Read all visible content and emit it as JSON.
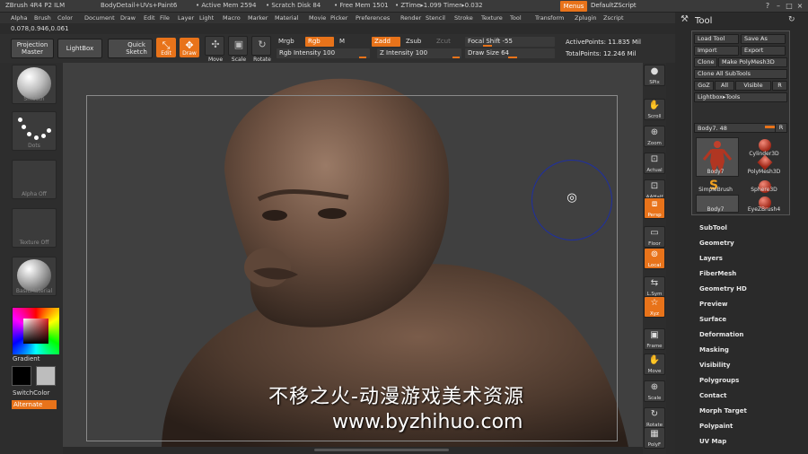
{
  "titlebar": {
    "app": "ZBrush 4R4 P2 ILM",
    "doc": "BodyDetail+UVs+Paint6",
    "active_mem": "• Active Mem 2594",
    "scratch": "• Scratch Disk 84",
    "free_mem": "• Free Mem 1501",
    "ztime": "• ZTime▸1.099  Timer▸0.032",
    "menus": "Menus",
    "script": "DefaultZScript"
  },
  "menubar": [
    "Alpha",
    "Brush",
    "Color",
    "Document",
    "Draw",
    "Edit",
    "File",
    "Layer",
    "Light",
    "Macro",
    "Marker",
    "Material",
    "Movie",
    "Picker",
    "Preferences",
    "Render",
    "Stencil",
    "Stroke",
    "Texture",
    "Tool",
    "Transform",
    "Zplugin",
    "Zscript"
  ],
  "shelf": {
    "coords": "0.078,0.946,0.061",
    "projection_master": "Projection Master",
    "lightbox": "LightBox",
    "quick_sketch": "Quick Sketch",
    "edit": "Edit",
    "draw": "Draw",
    "move": "Move",
    "scale": "Scale",
    "rotate": "Rotate",
    "mrgb": "Mrgb",
    "rgb": "Rgb",
    "m": "M",
    "rgb_intensity": "Rgb Intensity 100",
    "zadd": "Zadd",
    "zsub": "Zsub",
    "zcut": "Zcut",
    "z_intensity": "Z Intensity 100",
    "focal_shift": "Focal Shift -55",
    "draw_size": "Draw Size 64",
    "active_points": "ActivePoints: 11.835 Mil",
    "total_points": "TotalPoints: 12.246 Mil"
  },
  "left_tray": {
    "brush_caption": "Smooth",
    "stroke_caption": "Dots",
    "alpha_caption": "Alpha Off",
    "texture_caption": "Texture Off",
    "material_caption": "BasicMaterial",
    "gradient": "Gradient",
    "switchcolor": "SwitchColor",
    "alternate": "Alternate"
  },
  "canvas": {
    "watermark_line1": "不移之火-动漫游戏美术资源",
    "watermark_line2": "www.byzhihuo.com"
  },
  "right_tray": [
    "SPix",
    "Scroll",
    "Zoom",
    "Actual",
    "AAHalf",
    "Persp",
    "Floor",
    "Local",
    "L.Sym",
    "Xyz",
    "Frame",
    "Move",
    "Scale",
    "Rotate",
    "PolyF"
  ],
  "tool_panel": {
    "title": "Tool",
    "load_tool": "Load Tool",
    "save_as": "Save As",
    "import": "Import",
    "export": "Export",
    "clone": "Clone",
    "make_polymesh": "Make PolyMesh3D",
    "clone_all": "Clone All SubTools",
    "goz": "GoZ",
    "all": "All",
    "visible": "Visible",
    "r": "R",
    "lightbox_tools": "Lightbox▸Tools",
    "body_slider": "Body7. 48",
    "subtools": [
      "Body7",
      "Cylinder3D",
      "PolyMesh3D",
      "SimpleBrush",
      "Sphere3D",
      "Body7",
      "EyeZBrush4"
    ],
    "sections": [
      "SubTool",
      "Geometry",
      "Layers",
      "FiberMesh",
      "Geometry HD",
      "Preview",
      "Surface",
      "Deformation",
      "Masking",
      "Visibility",
      "Polygroups",
      "Contact",
      "Morph Target",
      "Polypaint",
      "UV Map"
    ]
  }
}
